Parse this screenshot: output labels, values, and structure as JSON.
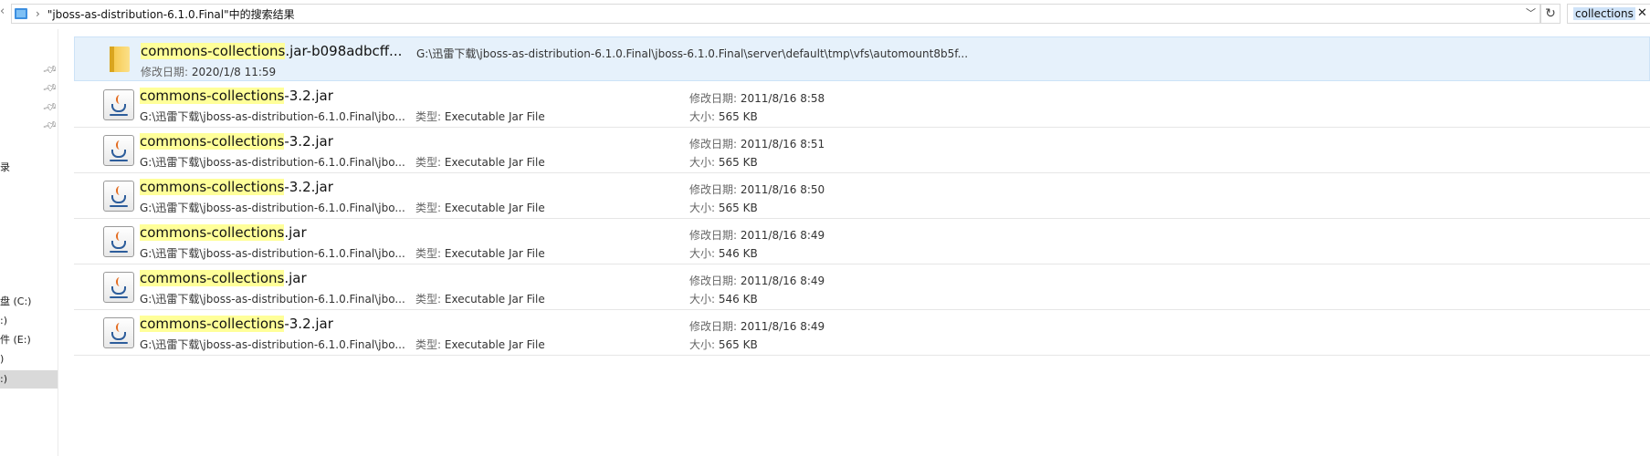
{
  "address_bar": {
    "path": "\"jboss-as-distribution-6.1.0.Final\"中的搜索结果"
  },
  "search": {
    "query": "collections"
  },
  "nav": {
    "items": [
      {
        "label": "录"
      },
      {
        "label": "盘 (C:)"
      },
      {
        "label": ":)"
      },
      {
        "label": "件 (E:)"
      },
      {
        "label": ")"
      },
      {
        "label": ":)"
      }
    ]
  },
  "results": [
    {
      "type": "folder",
      "name_hl": "commons-collections",
      "name_rest": ".jar-b098adbcff...",
      "location": "G:\\迅雷下载\\jboss-as-distribution-6.1.0.Final\\jboss-6.1.0.Final\\server\\default\\tmp\\vfs\\automount8b5f...",
      "modified_label": "修改日期:",
      "modified": "2020/1/8 11:59"
    },
    {
      "type": "jar",
      "name_hl": "commons-collections",
      "name_rest": "-3.2.jar",
      "location": "G:\\迅雷下载\\jboss-as-distribution-6.1.0.Final\\jbo...",
      "type_label": "类型:",
      "file_type": "Executable Jar File",
      "modified_label": "修改日期:",
      "modified": "2011/8/16 8:58",
      "size_label": "大小:",
      "size": "565 KB"
    },
    {
      "type": "jar",
      "name_hl": "commons-collections",
      "name_rest": "-3.2.jar",
      "location": "G:\\迅雷下载\\jboss-as-distribution-6.1.0.Final\\jbo...",
      "type_label": "类型:",
      "file_type": "Executable Jar File",
      "modified_label": "修改日期:",
      "modified": "2011/8/16 8:51",
      "size_label": "大小:",
      "size": "565 KB"
    },
    {
      "type": "jar",
      "name_hl": "commons-collections",
      "name_rest": "-3.2.jar",
      "location": "G:\\迅雷下载\\jboss-as-distribution-6.1.0.Final\\jbo...",
      "type_label": "类型:",
      "file_type": "Executable Jar File",
      "modified_label": "修改日期:",
      "modified": "2011/8/16 8:50",
      "size_label": "大小:",
      "size": "565 KB"
    },
    {
      "type": "jar",
      "name_hl": "commons-collections",
      "name_rest": ".jar",
      "location": "G:\\迅雷下载\\jboss-as-distribution-6.1.0.Final\\jbo...",
      "type_label": "类型:",
      "file_type": "Executable Jar File",
      "modified_label": "修改日期:",
      "modified": "2011/8/16 8:49",
      "size_label": "大小:",
      "size": "546 KB"
    },
    {
      "type": "jar",
      "name_hl": "commons-collections",
      "name_rest": ".jar",
      "location": "G:\\迅雷下载\\jboss-as-distribution-6.1.0.Final\\jbo...",
      "type_label": "类型:",
      "file_type": "Executable Jar File",
      "modified_label": "修改日期:",
      "modified": "2011/8/16 8:49",
      "size_label": "大小:",
      "size": "546 KB"
    },
    {
      "type": "jar",
      "name_hl": "commons-collections",
      "name_rest": "-3.2.jar",
      "location": "G:\\迅雷下载\\jboss-as-distribution-6.1.0.Final\\jbo...",
      "type_label": "类型:",
      "file_type": "Executable Jar File",
      "modified_label": "修改日期:",
      "modified": "2011/8/16 8:49",
      "size_label": "大小:",
      "size": "565 KB"
    }
  ]
}
